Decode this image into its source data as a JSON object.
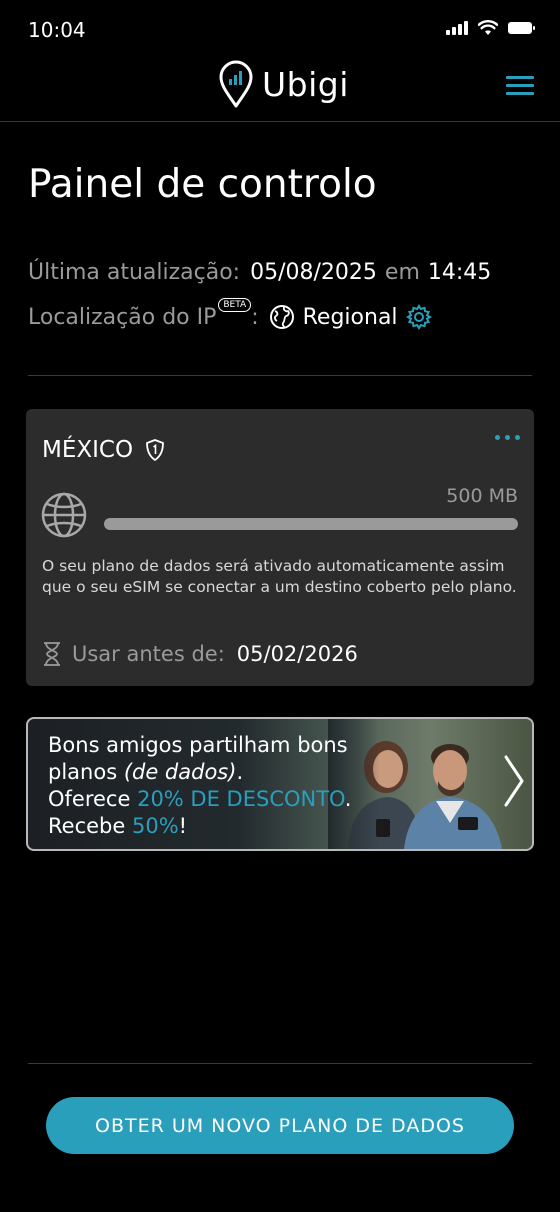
{
  "status_bar": {
    "time": "10:04"
  },
  "header": {
    "brand": "Ubigi",
    "accent_color": "#2a9fbc"
  },
  "page": {
    "title": "Painel de controlo"
  },
  "last_update": {
    "label": "Última atualização:",
    "date": "05/08/2025",
    "connector": "em",
    "time": "14:45"
  },
  "ip_location": {
    "label": "Localização do IP",
    "badge": "BETA",
    "colon": ":",
    "value": "Regional"
  },
  "plan": {
    "country": "MÉXICO",
    "amount": "500 MB",
    "usage_fraction": 0,
    "note": "O seu plano de dados será ativado automaticamente assim que o seu eSIM se conectar a um destino coberto pelo plano.",
    "use_before_label": "Usar antes de:",
    "use_before_date": "05/02/2026"
  },
  "promo": {
    "line1_a": "Bons amigos partilham ",
    "line1_b": "bons",
    "line2_a": "planos ",
    "line2_b": "(de dados)",
    "line2_c": ".",
    "line3_a": "Oferece ",
    "line3_b": "20% DE DESCONTO",
    "line3_c": ".",
    "line4_a": "Recebe ",
    "line4_b": "50%",
    "line4_c": "!"
  },
  "cta": {
    "label": "OBTER UM NOVO PLANO DE DADOS"
  },
  "icons": {
    "status": [
      "signal-icon",
      "wifi-icon",
      "battery-icon"
    ],
    "header": [
      "location-pin-icon",
      "hamburger-menu-icon"
    ],
    "card": [
      "shield-icon",
      "more-dots-icon",
      "globe-icon",
      "hourglass-icon"
    ],
    "other": [
      "world-icon",
      "gear-icon",
      "chevron-right-icon"
    ]
  }
}
